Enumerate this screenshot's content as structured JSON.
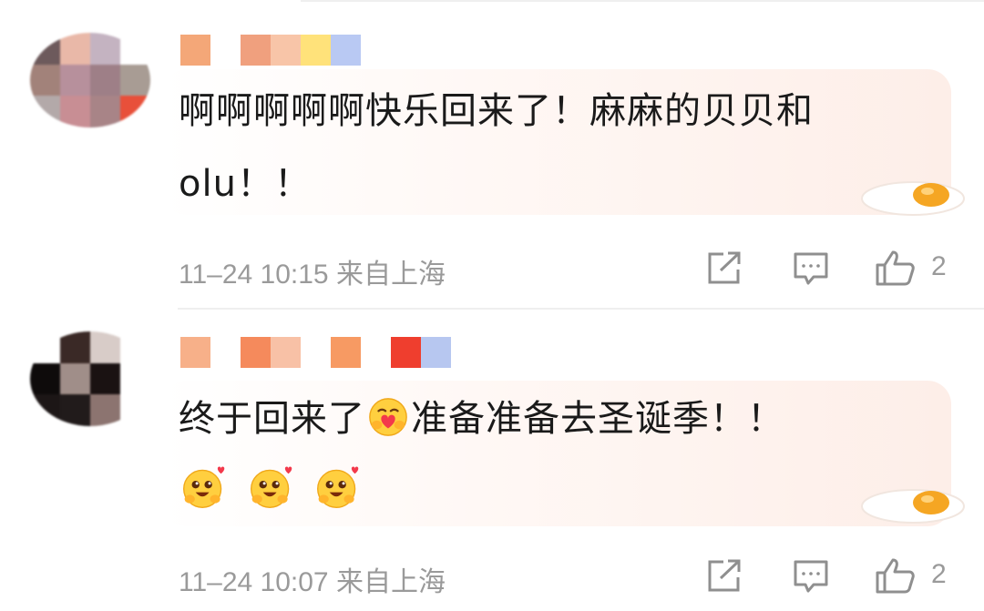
{
  "comments": [
    {
      "text_line1": "啊啊啊啊啊快乐回来了！麻麻的贝贝和",
      "text_line2": "olu！！",
      "meta": "11–24 10:15 来自上海",
      "like_count": "2",
      "avatar_tiles": [
        "#6d5a5c",
        "#e9b8a8",
        "#c4b3c1",
        "#ffffff",
        "#a2827a",
        "#b7909c",
        "#9e7f87",
        "#a89c94",
        "#b3a9a9",
        "#c88e94",
        "#a88487",
        "#e8503a"
      ],
      "username_tiles": [
        "#f4a778",
        "#ffffff",
        "#f0a07e",
        "#f8c5a8",
        "#ffe27a",
        "#b9c9f3"
      ]
    },
    {
      "text_line1_a": "终于回来了",
      "text_line1_b": "准备准备去圣诞季！！",
      "meta": "11–24 10:07 来自上海",
      "like_count": "2",
      "avatar_tiles": [
        "#ffffff",
        "#3a2926",
        "#d8ccc8",
        "#ffffff",
        "#0e0b0b",
        "#a08e89",
        "#1a1212",
        "#ffffff",
        "#1c1616",
        "#211b1b",
        "#8c7470",
        "#ffffff"
      ],
      "username_tiles": [
        "#f7b089",
        "#ffffff",
        "#f58a5c",
        "#f8c1a6",
        "#ffffff",
        "#f79a63",
        "#ffffff",
        "#ef3e2e",
        "#b7c7f0"
      ]
    }
  ],
  "icons": {
    "share": "share-icon",
    "reply": "comment-icon",
    "like": "thumbs-up-icon",
    "emoji_hug": "hug-emoji-icon",
    "emoji_love": "heart-eyes-emoji-icon",
    "sticker": "fried-egg-icon"
  },
  "colors": {
    "text": "#1a1a1a",
    "meta": "#9a9a9a",
    "bubble": "#fdeee8"
  }
}
